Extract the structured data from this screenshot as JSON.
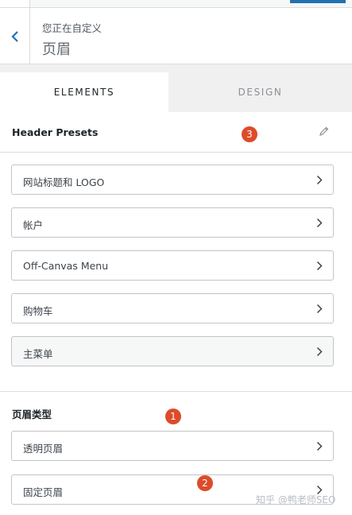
{
  "header": {
    "subtitle": "您正在自定义",
    "title": "页眉"
  },
  "tabs": [
    {
      "label": "ELEMENTS",
      "active": true
    },
    {
      "label": "DESIGN",
      "active": false
    }
  ],
  "presets": {
    "title": "Header Presets"
  },
  "elements": [
    {
      "label": "网站标题和 LOGO"
    },
    {
      "label": "帐户"
    },
    {
      "label": "Off-Canvas Menu"
    },
    {
      "label": "购物车"
    },
    {
      "label": "主菜单"
    }
  ],
  "header_types": {
    "title": "页眉类型",
    "items": [
      {
        "label": "透明页眉"
      },
      {
        "label": "固定页眉"
      }
    ]
  },
  "badges": [
    "1",
    "2",
    "3"
  ],
  "watermark": "知乎 @鸭老师SEO",
  "colors": {
    "accent": "#2271b1",
    "badge": "#dd4b2a"
  }
}
